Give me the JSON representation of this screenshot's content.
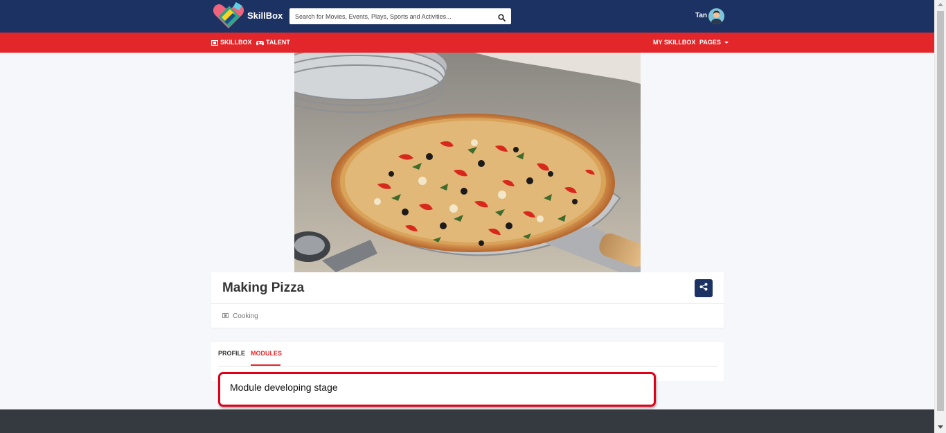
{
  "header": {
    "brand": "SkillBox",
    "search_placeholder": "Search for Movies, Events, Plays, Sports and Activities...",
    "user_name": "Tan"
  },
  "nav": {
    "skillbox": "SKILLBOX",
    "talent": "TALENT",
    "my_skillbox": "MY SKILLBOX",
    "pages": "PAGES"
  },
  "course": {
    "title": "Making Pizza",
    "category": "Cooking"
  },
  "tabs": {
    "profile": "PROFILE",
    "modules": "MODULES",
    "active": "MODULES"
  },
  "modules": {
    "message": "Module developing stage"
  },
  "colors": {
    "header_bg": "#1c3263",
    "nav_bg": "#e3262a",
    "accent": "#e3262a",
    "footer_bg": "#343a40"
  }
}
